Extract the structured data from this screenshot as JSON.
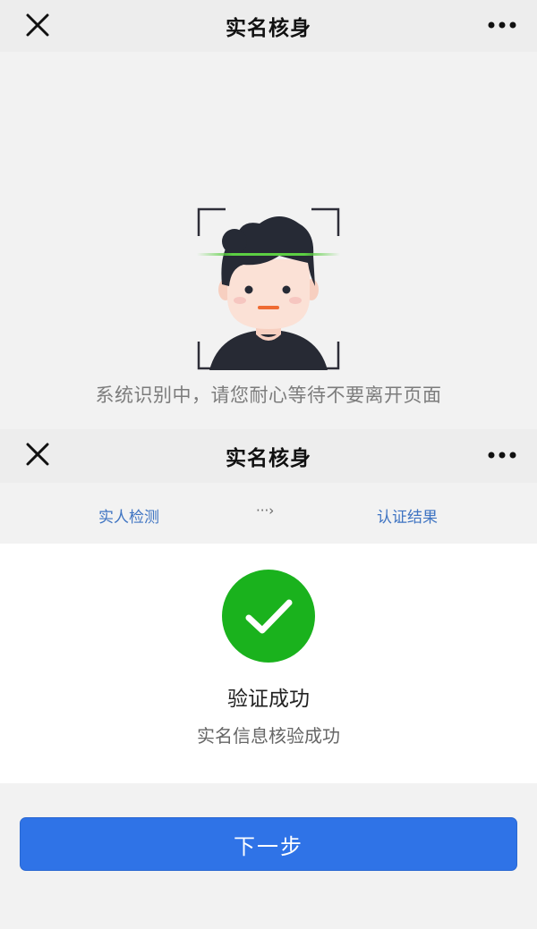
{
  "screen_top": {
    "nav": {
      "title": "实名核身",
      "close_icon": "close-icon",
      "more_icon": "more-dots-icon"
    },
    "scan": {
      "hint": "系统识别中，请您耐心等待不要离开页面",
      "scan_line_color": "#5ccf43"
    }
  },
  "screen_bottom": {
    "nav": {
      "title": "实名核身",
      "close_icon": "close-icon",
      "more_icon": "more-dots-icon"
    },
    "steps": {
      "step1": "实人检测",
      "arrow": "···›",
      "step2": "认证结果"
    },
    "result": {
      "icon": "success-check-icon",
      "icon_color": "#1ab21d",
      "title": "验证成功",
      "description": "实名信息核验成功"
    },
    "next_button": {
      "label": "下一步",
      "color": "#2f73e7"
    }
  }
}
